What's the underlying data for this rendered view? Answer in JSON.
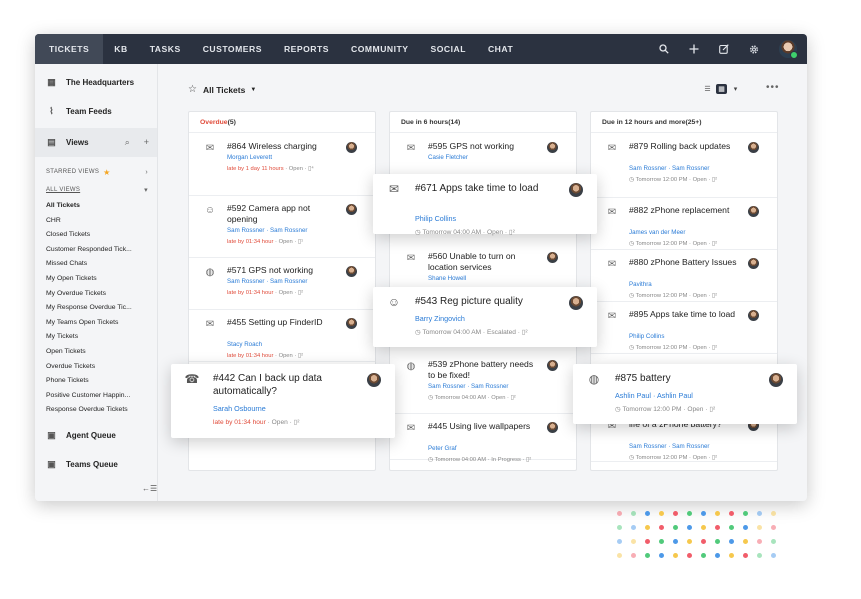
{
  "nav": {
    "tabs": [
      "TICKETS",
      "KB",
      "TASKS",
      "CUSTOMERS",
      "REPORTS",
      "COMMUNITY",
      "SOCIAL",
      "CHAT"
    ],
    "icons": [
      "search-icon",
      "plus-icon",
      "compose-icon",
      "gear-icon",
      "avatar"
    ]
  },
  "sidebar": {
    "headquarters": "The Headquarters",
    "team_feeds": "Team Feeds",
    "views": "Views",
    "starred_views": "STARRED VIEWS",
    "all_views": "ALL VIEWS",
    "view_items": [
      "All Tickets",
      "CHR",
      "Closed Tickets",
      "Customer Responded Tick...",
      "Missed Chats",
      "My Open Tickets",
      "My Overdue Tickets",
      "My Response Overdue Tic...",
      "My Teams Open Tickets",
      "My Tickets",
      "Open Tickets",
      "Overdue Tickets",
      "Phone Tickets",
      "Positive Customer Happin...",
      "Response Overdue Tickets"
    ],
    "agent_queue": "Agent Queue",
    "teams_queue": "Teams Queue",
    "collapse": "←☰"
  },
  "header": {
    "all_tickets": "All Tickets",
    "more": "•••"
  },
  "columns": [
    {
      "prefix": "Overdue",
      "count": " (5)",
      "cards": [
        {
          "title": "#864 Wireless charging",
          "agent": "Morgan Leverett",
          "meta_red": "late by 1 day 11 hours",
          "meta": " · Open · ▯⁴"
        },
        {
          "title": "#592 Camera app not opening",
          "agent": "Sam Rossner  ·  Sam Rossner",
          "meta_red": "late by 01:34 hour",
          "meta": " · Open · ▯¹"
        },
        {
          "title": "#571 GPS not working",
          "agent": "Sam Rossner  ·  Sam Rossner",
          "meta_red": "late by 01:34 hour",
          "meta": " · Open · ▯²"
        },
        {
          "title": "#455 Setting up FinderID",
          "agent": "Stacy Roach",
          "meta_red": "late by 01:34 hour",
          "meta": " · Open · ▯²"
        }
      ]
    },
    {
      "prefix": "Due in 6 hours",
      "count": " (14)",
      "cards": [
        {
          "title": "#595 GPS not working",
          "agent": "Casie Fletcher",
          "meta_red": "",
          "meta": ""
        },
        {
          "title": "#560 Unable to turn on location services",
          "agent": "Shane Howell",
          "meta_red": "",
          "meta": ""
        },
        {
          "title": "#539 zPhone battery needs to be fixed!",
          "agent": "Sam Rossner  ·  Sam Rossner",
          "meta_red": "",
          "meta": "◷ Tomorrow 04:00 AM · Open · ▯²"
        },
        {
          "title": "#445 Using live wallpapers",
          "agent": "Peter Graf",
          "meta_red": "",
          "meta": "◷ Tomorrow 04:00 AM · In Progress · ▯²"
        }
      ]
    },
    {
      "prefix": "Due in 12 hours and more",
      "count": " (25+)",
      "cards": [
        {
          "title": "#879 Rolling back updates",
          "agent": "Sam Rossner  ·  Sam Rossner",
          "meta_red": "",
          "meta": "◷ Tomorrow 12:00 PM · Open · ▯²"
        },
        {
          "title": "#882 zPhone replacement",
          "agent": "James van der Meer",
          "meta_red": "",
          "meta": "◷ Tomorrow 12:00 PM · Open · ▯²"
        },
        {
          "title": "#880 zPhone Battery Issues",
          "agent": "Pavithra",
          "meta_red": "",
          "meta": "◷ Tomorrow 12:00 PM · Open · ▯²"
        },
        {
          "title": "#895 Apps take time to load",
          "agent": "Philip Collins",
          "meta_red": "",
          "meta": "◷ Tomorrow 12:00 PM · Open · ▯²"
        },
        {
          "title": "life of a zPhone battery?",
          "agent": "Sam Rossner  ·  Sam Rossner",
          "meta_red": "",
          "meta": "◷ Tomorrow 12:00 PM · Open · ▯²"
        }
      ]
    }
  ],
  "floating": [
    {
      "title": "#671 Apps take time to load",
      "agent": "Philip Collins",
      "meta_red": "",
      "meta": "◷ Tomorrow 04:00 AM · Open · ▯²"
    },
    {
      "title": "#543 Reg picture quality",
      "agent": "Barry Zingovich",
      "meta_red": "",
      "meta": "◷ Tomorrow 04:00 AM · Escalated · ▯²"
    },
    {
      "title": "#442 Can I back up data automatically?",
      "agent": "Sarah Osbourne",
      "meta_red": "late by 01:34 hour",
      "meta": " · Open · ▯²"
    },
    {
      "title": "#875 battery",
      "agent": "Ashlin Paul  ·  Ashlin Paul",
      "meta_red": "",
      "meta": "◷ Tomorrow 12:00 PM · Open · ▯²"
    }
  ],
  "dot_colors": [
    "#f04b5a",
    "#3ec46d",
    "#3a8ee6",
    "#f5c23a"
  ]
}
